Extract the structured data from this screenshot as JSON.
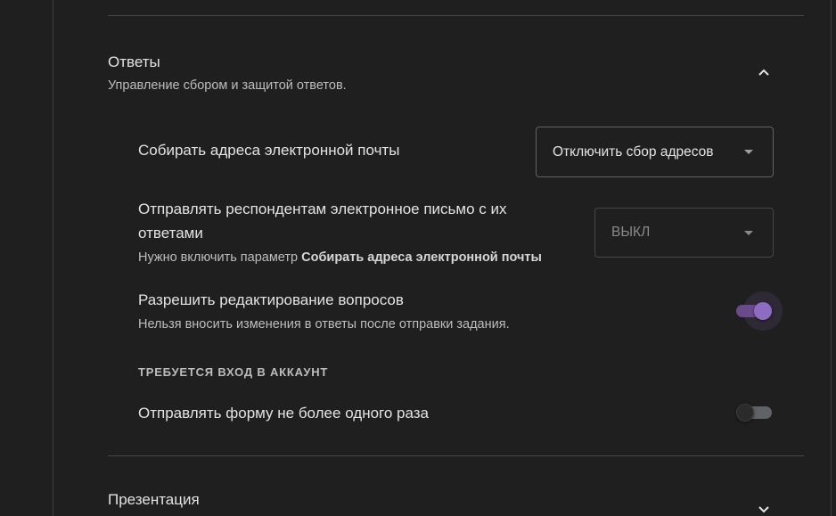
{
  "colors": {
    "background": "#1f1f1f",
    "accent": "#8e6cc2",
    "text_primary": "#e3e3e3",
    "text_secondary": "#bdbdbd"
  },
  "responses_section": {
    "title": "Ответы",
    "subtitle": "Управление сбором и защитой ответов.",
    "expanded": true,
    "icon": "chevron-up-icon",
    "settings": {
      "collect_emails": {
        "label": "Собирать адреса электронной почты",
        "selected": "Отключить сбор адресов"
      },
      "send_copy": {
        "label_line1": "Отправлять респондентам электронное письмо с их",
        "label_line2": "ответами",
        "hint_prefix": "Нужно включить параметр ",
        "hint_bold": "Собирать адреса электронной почты",
        "selected": "ВЫКЛ",
        "disabled": true
      },
      "allow_edit": {
        "label": "Разрешить редактирование вопросов",
        "hint": "Нельзя вносить изменения в ответы после отправки задания.",
        "enabled": true
      }
    },
    "requires_signin": {
      "heading": "ТРЕБУЕТСЯ ВХОД В АККАУНТ",
      "limit_one": {
        "label": "Отправлять форму не более одного раза",
        "enabled": false
      }
    }
  },
  "presentation_section": {
    "title": "Презентация",
    "expanded": false,
    "icon": "chevron-down-icon"
  }
}
